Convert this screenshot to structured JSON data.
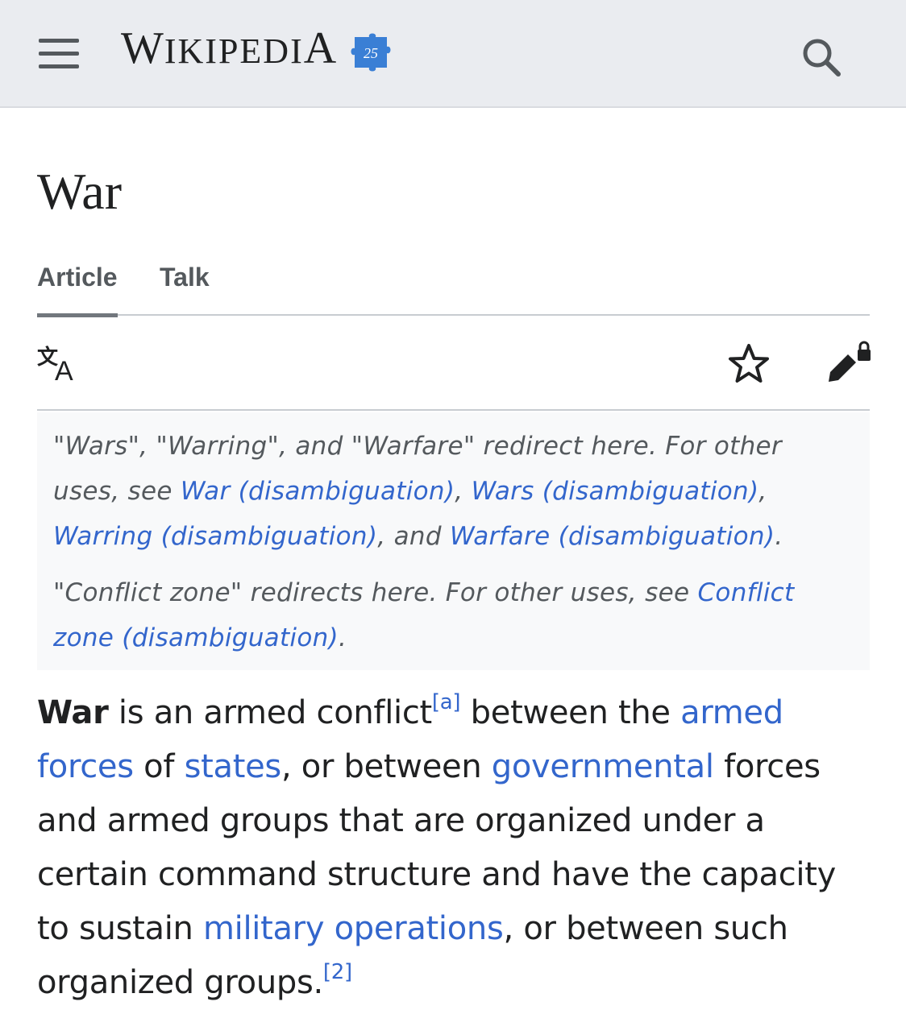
{
  "header": {
    "logo_first": "W",
    "logo_rest": "IKIPEDI",
    "logo_last": "A",
    "puzzle_number": "25"
  },
  "page": {
    "title": "War"
  },
  "tabs": [
    {
      "label": "Article",
      "active": true
    },
    {
      "label": "Talk",
      "active": false
    }
  ],
  "toolbar": {
    "language_icon": "translate-icon",
    "watch_icon": "star-icon",
    "edit_icon": "edit-lock-icon"
  },
  "hatnote": {
    "line1_text": "\"Wars\", \"Warring\", and \"Warfare\" redirect here. For other uses, see ",
    "link_war": "War (disambiguation)",
    "sep1": ", ",
    "link_wars": "Wars (disambiguation)",
    "sep2": ", ",
    "link_warring": "Warring (disambiguation)",
    "sep3": ", and ",
    "link_warfare": "Warfare (disambiguation)",
    "end1": ".",
    "line2_text": "\"Conflict zone\" redirects here. For other uses, see ",
    "link_conflict": "Conflict zone (disambiguation)",
    "end2": "."
  },
  "lead": {
    "bold": "War",
    "t1": " is an armed conflict",
    "note_a": "[a]",
    "t2": " between the ",
    "link_armed_forces": "armed forces",
    "t3": " of ",
    "link_states": "states",
    "t4": ", or between ",
    "link_governmental": "governmental",
    "t5": " forces and armed groups that are organized under a certain command structure and have the capacity to sustain ",
    "link_military_operations": "military operations",
    "t6": ", or between such organized groups.",
    "note_2": "[2]"
  },
  "colors": {
    "link": "#3366cc",
    "header_bg": "#eaecf0",
    "puzzle": "#3a7fd5"
  }
}
